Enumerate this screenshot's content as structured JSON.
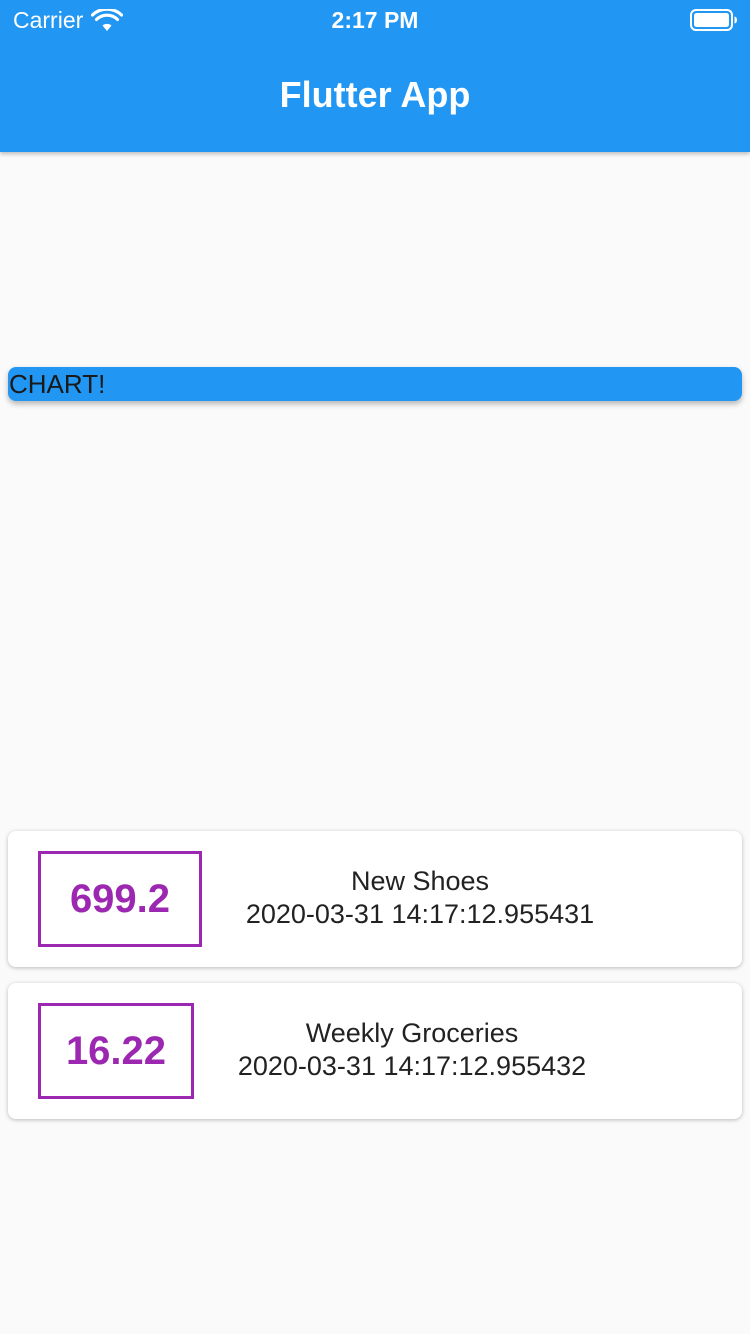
{
  "status_bar": {
    "carrier": "Carrier",
    "time": "2:17 PM",
    "icons": [
      "wifi-icon",
      "battery-icon"
    ]
  },
  "app_bar": {
    "title": "Flutter App",
    "color": "#2196f3"
  },
  "chart": {
    "label": "CHART!"
  },
  "transactions": [
    {
      "amount": "699.2",
      "title": "New Shoes",
      "date": "2020-03-31 14:17:12.955431"
    },
    {
      "amount": "16.22",
      "title": "Weekly Groceries",
      "date": "2020-03-31 14:17:12.955432"
    }
  ],
  "colors": {
    "primary": "#2196f3",
    "amount_accent": "#9c27b0",
    "background": "#fafafa"
  }
}
